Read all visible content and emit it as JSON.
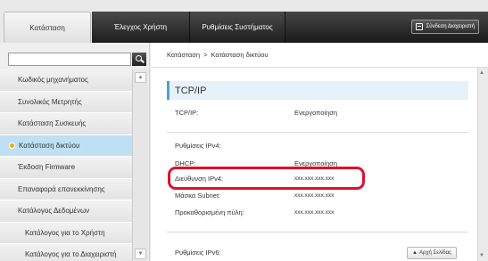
{
  "tabs": [
    {
      "label": "Κατάσταση"
    },
    {
      "label": "Έλεγχος Χρήστη"
    },
    {
      "label": "Ρυθμίσεις Συστήματος"
    }
  ],
  "login_button": "Σύνδεση Διαχειριστή",
  "search": {
    "placeholder": ""
  },
  "sidebar": {
    "items": [
      {
        "label": "Κωδικός μηχανήματος"
      },
      {
        "label": "Συνολικός Μετρητής"
      },
      {
        "label": "Κατάσταση Συσκευής"
      },
      {
        "label": "Κατάσταση δικτύου"
      },
      {
        "label": "Έκδοση Firmware"
      },
      {
        "label": "Επαναφορά επανεκκίνησης"
      },
      {
        "label": "Κατάλογος Δεδομένων"
      },
      {
        "label": "Κατάλογος για το Χρήστη"
      },
      {
        "label": "Κατάλογος για το Διαχειριστή"
      }
    ]
  },
  "breadcrumb": {
    "root": "Κατάσταση",
    "separator": ">",
    "current": "Κατάσταση δικτύου"
  },
  "section": {
    "title": "TCP/IP"
  },
  "rows": {
    "tcpip": {
      "label": "TCP/IP:",
      "value": "Ενεργοποίηση"
    },
    "ipv4_settings": {
      "label": "Ρυθμίσεις IPv4:"
    },
    "dhcp": {
      "label": "DHCP:",
      "value": "Ενεργοποίηση"
    },
    "ipv4_address": {
      "label": "Διεύθυνση IPv4:",
      "value": "xxx.xxx.xxx.xxx"
    },
    "subnet": {
      "label": "Μάσκα Subnet:",
      "value": "xxx.xxx.xxx.xxx"
    },
    "gateway": {
      "label": "Προκαθορισμένη πύλη:",
      "value": "xxx.xxx.xxx.xxx"
    },
    "ipv6_settings": {
      "label": "Ρυθμίσεις IPv6:"
    }
  },
  "top_button": "Αρχή Σελίδας",
  "colors": {
    "accent": "#4aa3d6",
    "highlight": "#e0102c",
    "active_nav": "#bfe0f4"
  }
}
